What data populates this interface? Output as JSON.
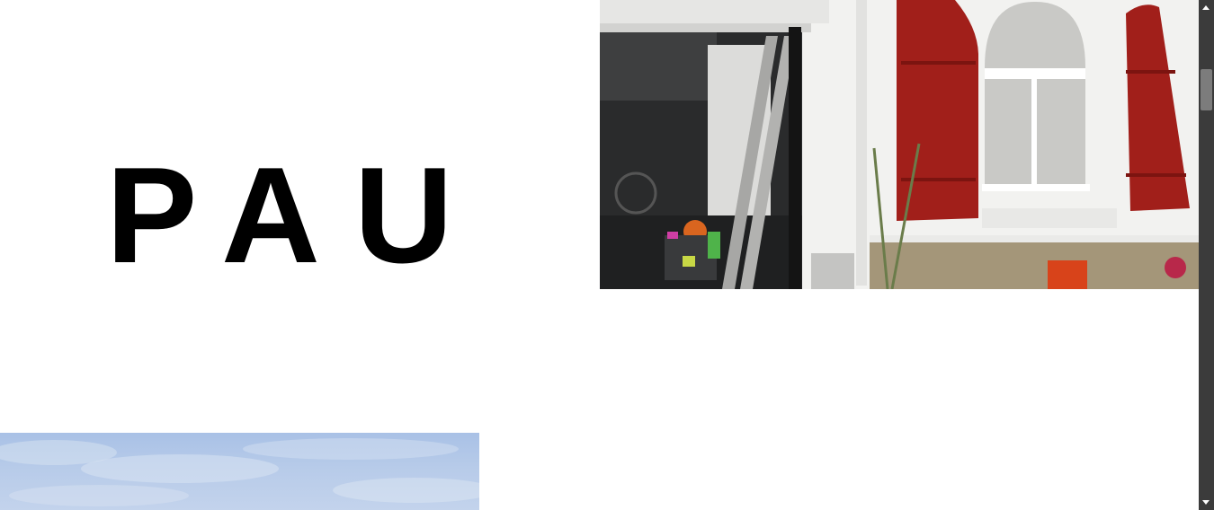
{
  "hero": {
    "title": "PAU"
  },
  "images": {
    "house_photo_icon": "photo-garage-house",
    "sky_photo_icon": "photo-blue-sky"
  },
  "colors": {
    "background": "#ffffff",
    "title": "#000000",
    "shutter_red": "#a11f1a",
    "scrollbar_track": "#3b3b3b",
    "scrollbar_thumb": "#7c7c7c"
  },
  "scrollbar": {
    "position_fraction": 0.12
  }
}
